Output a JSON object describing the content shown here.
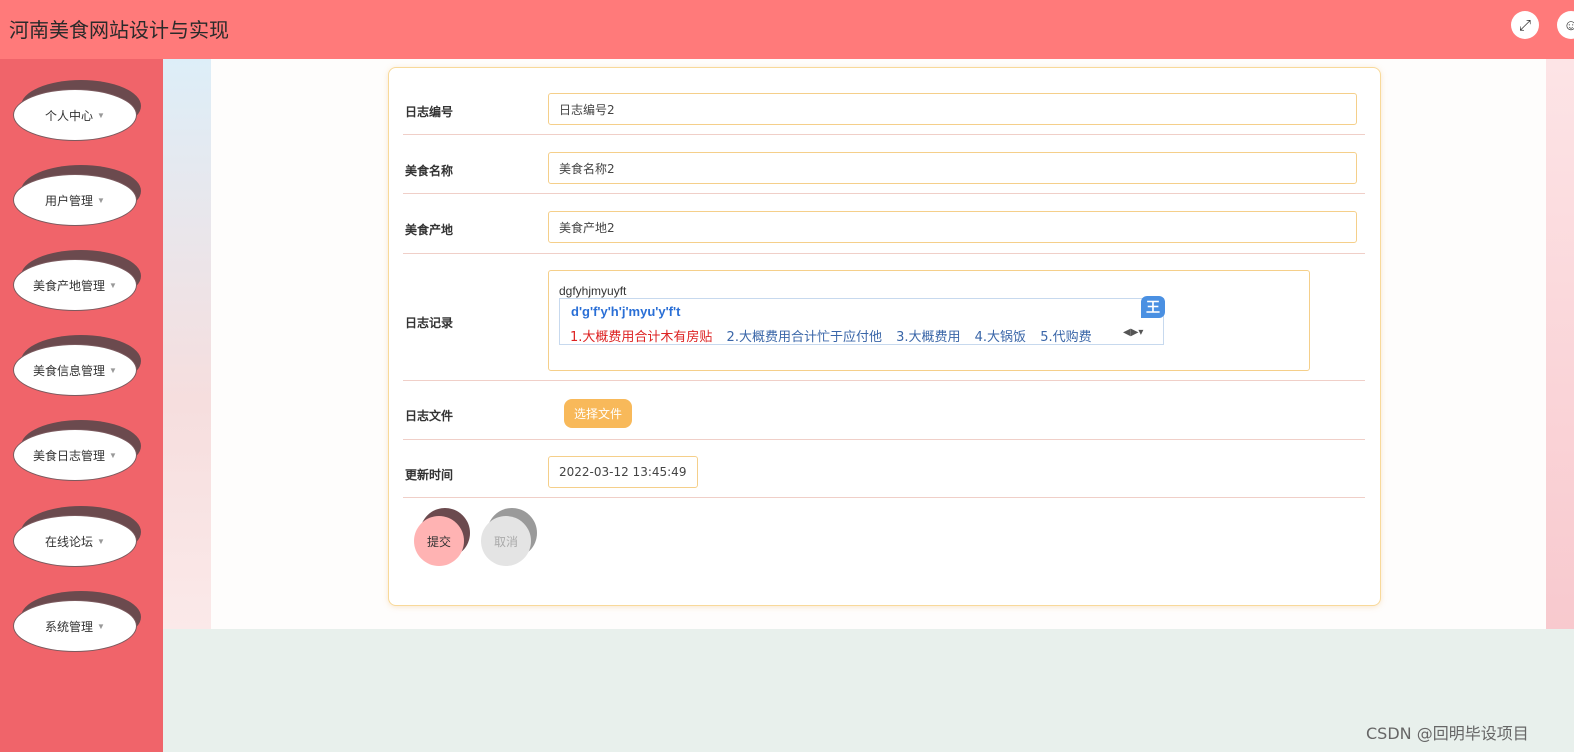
{
  "header": {
    "title": "河南美食网站设计与实现",
    "fullscreen_icon": "expand-icon",
    "user_icon": "user-icon"
  },
  "sidebar": {
    "items": [
      {
        "label": "个人中心"
      },
      {
        "label": "用户管理"
      },
      {
        "label": "美食产地管理"
      },
      {
        "label": "美食信息管理"
      },
      {
        "label": "美食日志管理"
      },
      {
        "label": "在线论坛"
      },
      {
        "label": "系统管理"
      }
    ]
  },
  "form": {
    "log_no_label": "日志编号",
    "log_no_value": "日志编号2",
    "food_name_label": "美食名称",
    "food_name_value": "美食名称2",
    "origin_label": "美食产地",
    "origin_value": "美食产地2",
    "record_label": "日志记录",
    "record_value": "dgfyhjmyuyft",
    "file_label": "日志文件",
    "file_button": "选择文件",
    "update_time_label": "更新时间",
    "update_time_value": "2022-03-12 13:45:49",
    "submit_label": "提交",
    "cancel_label": "取消"
  },
  "ime": {
    "pinyin": "d'g'f'y'h'j'myu'y'f't",
    "candidates": [
      "1.大概费用合计木有房贴",
      "2.大概费用合计忙于应付他",
      "3.大概费用",
      "4.大锅饭",
      "5.代购费"
    ],
    "logo": "王"
  },
  "watermark": "CSDN @回明毕设项目"
}
